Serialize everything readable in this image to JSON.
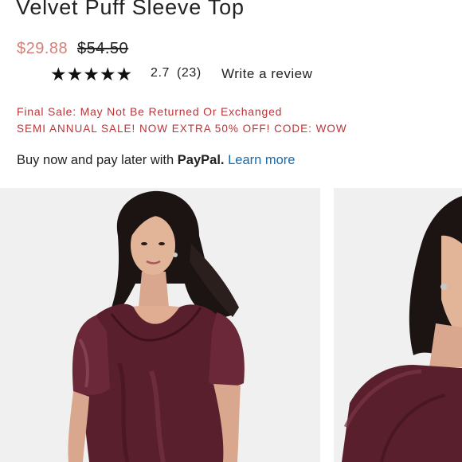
{
  "product": {
    "title": "Velvet Puff Sleeve Top",
    "sale_price": "$29.88",
    "original_price": "$54.50",
    "stars": "★★★★★",
    "rating": "2.7",
    "review_count": "(23)",
    "write_review_label": "Write a review"
  },
  "promos": {
    "final_sale": "Final Sale: May Not Be Returned Or Exchanged",
    "semi_annual": "SEMI ANNUAL SALE! NOW EXTRA 50% OFF! CODE: WOW"
  },
  "paypal": {
    "prefix": "Buy now and pay later with ",
    "brand": "PayPal.",
    "learn_more": "Learn more"
  },
  "colors": {
    "sale_price": "#d4807a",
    "promo_text": "#b8353a",
    "link": "#1a6aa8",
    "velvet": "#5a1f2c"
  },
  "gallery": {
    "images": [
      "model-front-photo",
      "model-side-photo"
    ]
  }
}
